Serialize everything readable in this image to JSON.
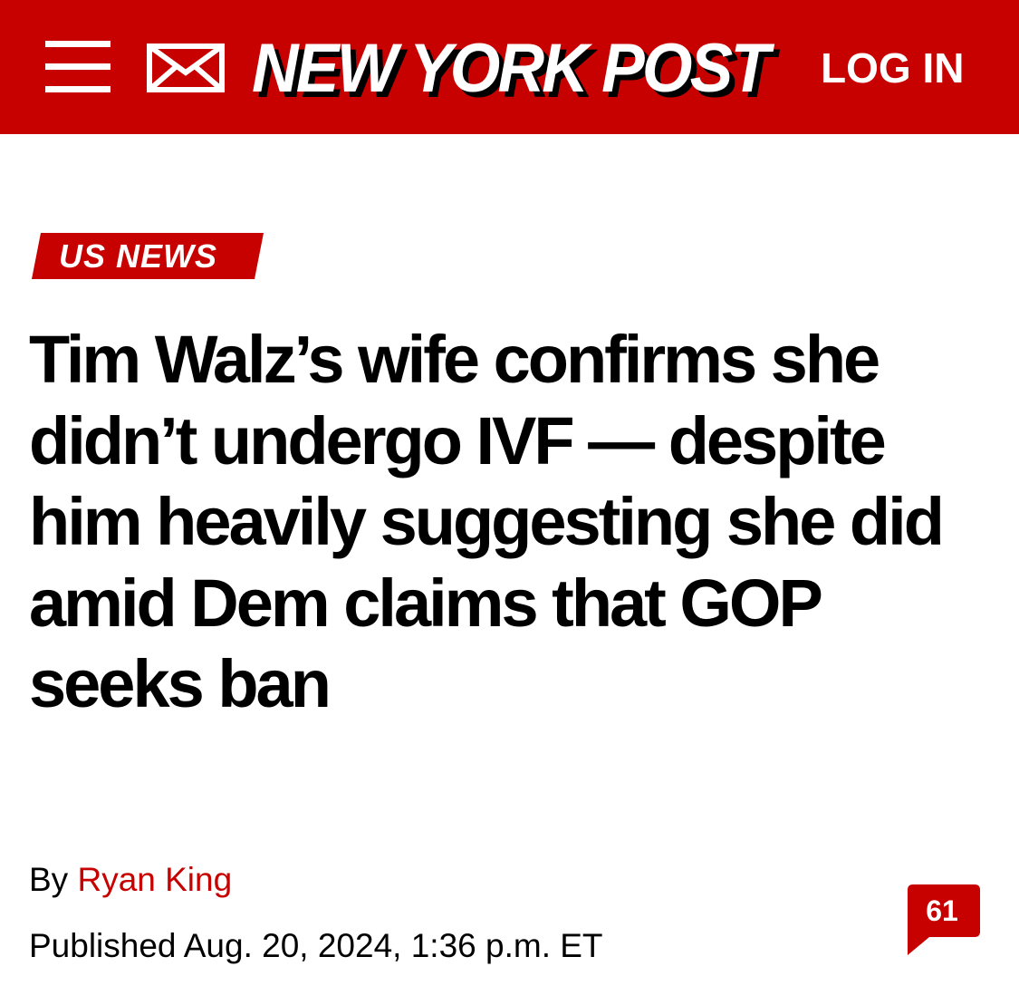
{
  "header": {
    "logo_text": "NEW YORK POST",
    "login_label": "LOG IN",
    "menu_icon": "hamburger-menu-icon",
    "mail_icon": "envelope-icon"
  },
  "article": {
    "section": "US NEWS",
    "headline": "Tim Walz’s wife confirms she didn’t undergo IVF — despite him heavily suggesting she did amid Dem claims that GOP seeks ban",
    "byline_prefix": "By",
    "author": "Ryan King",
    "published": "Published Aug. 20, 2024, 1:36 p.m. ET",
    "comment_count": "61"
  },
  "colors": {
    "brand_red": "#c70000",
    "text": "#000000",
    "background": "#ffffff"
  }
}
